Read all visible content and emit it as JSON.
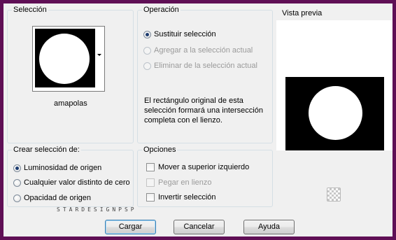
{
  "seleccion": {
    "title": "Selección",
    "selected_value": "amapolas",
    "dropdown_icon": "chevron-down-icon"
  },
  "operacion": {
    "title": "Operación",
    "options": [
      {
        "label": "Sustituir selección",
        "checked": true,
        "enabled": true
      },
      {
        "label": "Agregar a la selección actual",
        "checked": false,
        "enabled": false
      },
      {
        "label": "Eliminar de la selección actual",
        "checked": false,
        "enabled": false
      }
    ],
    "description": [
      "El rectángulo original de esta",
      "selección formará una intersección",
      "completa con el lienzo."
    ]
  },
  "vista_previa": {
    "title": "Vista previa",
    "toggle_icon": "checkerboard-icon"
  },
  "crear_seleccion": {
    "title": "Crear selección de:",
    "options": [
      {
        "label": "Luminosidad de origen",
        "checked": true
      },
      {
        "label": "Cualquier valor distinto de cero",
        "checked": false
      },
      {
        "label": "Opacidad de origen",
        "checked": false
      }
    ]
  },
  "opciones": {
    "title": "Opciones",
    "checkboxes": [
      {
        "label": "Mover a superior izquierdo",
        "checked": false,
        "enabled": true
      },
      {
        "label": "Pegar en lienzo",
        "checked": false,
        "enabled": false
      },
      {
        "label": "Invertir selección",
        "checked": false,
        "enabled": true
      }
    ]
  },
  "watermark": "STARDESIGNPSP",
  "buttons": {
    "load": "Cargar",
    "cancel": "Cancelar",
    "help": "Ayuda"
  },
  "colors": {
    "frame": "#5f0f55",
    "dialog_bg": "#f0f0f0",
    "group_border": "#d5dfe5"
  }
}
